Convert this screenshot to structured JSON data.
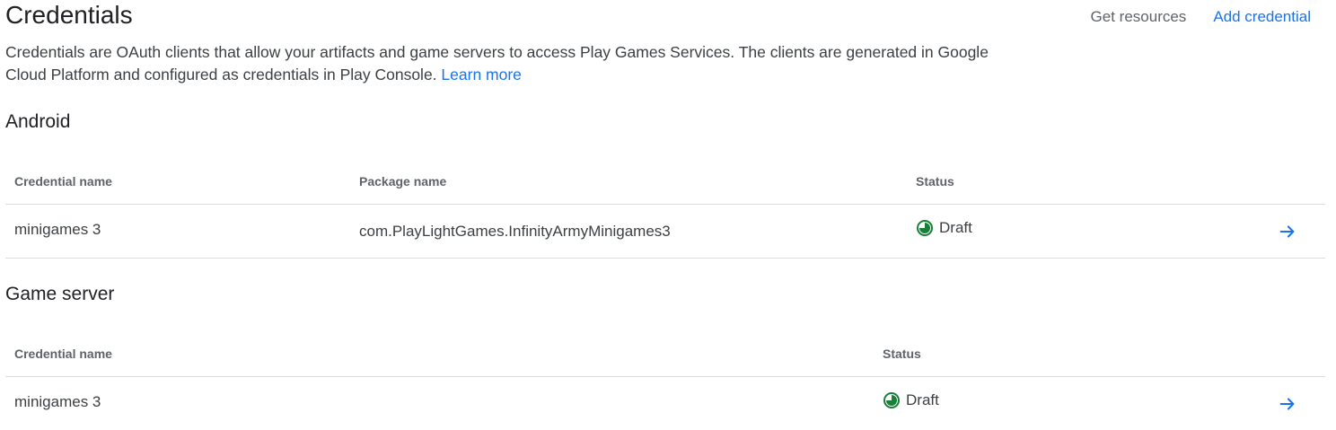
{
  "header": {
    "title": "Credentials",
    "get_resources": "Get resources",
    "add_credential": "Add credential"
  },
  "description": {
    "text": "Credentials are OAuth clients that allow your artifacts and game servers to access Play Games Services. The clients are generated in Google Cloud Platform and configured as credentials in Play Console.",
    "link": "Learn more"
  },
  "android": {
    "title": "Android",
    "columns": [
      "Credential name",
      "Package name",
      "Status"
    ],
    "rows": [
      {
        "name": "minigames 3",
        "package": "com.PlayLightGames.InfinityArmyMinigames3",
        "status": "Draft"
      }
    ]
  },
  "game_server": {
    "title": "Game server",
    "columns": [
      "Credential name",
      "Status"
    ],
    "rows": [
      {
        "name": "minigames 3",
        "status": "Draft"
      }
    ]
  },
  "icons": {
    "status": "draft-status-icon",
    "open": "arrow-forward-icon"
  },
  "colors": {
    "accent": "#1a73e8",
    "draft_status": "#188038",
    "divider": "#dadce0"
  }
}
